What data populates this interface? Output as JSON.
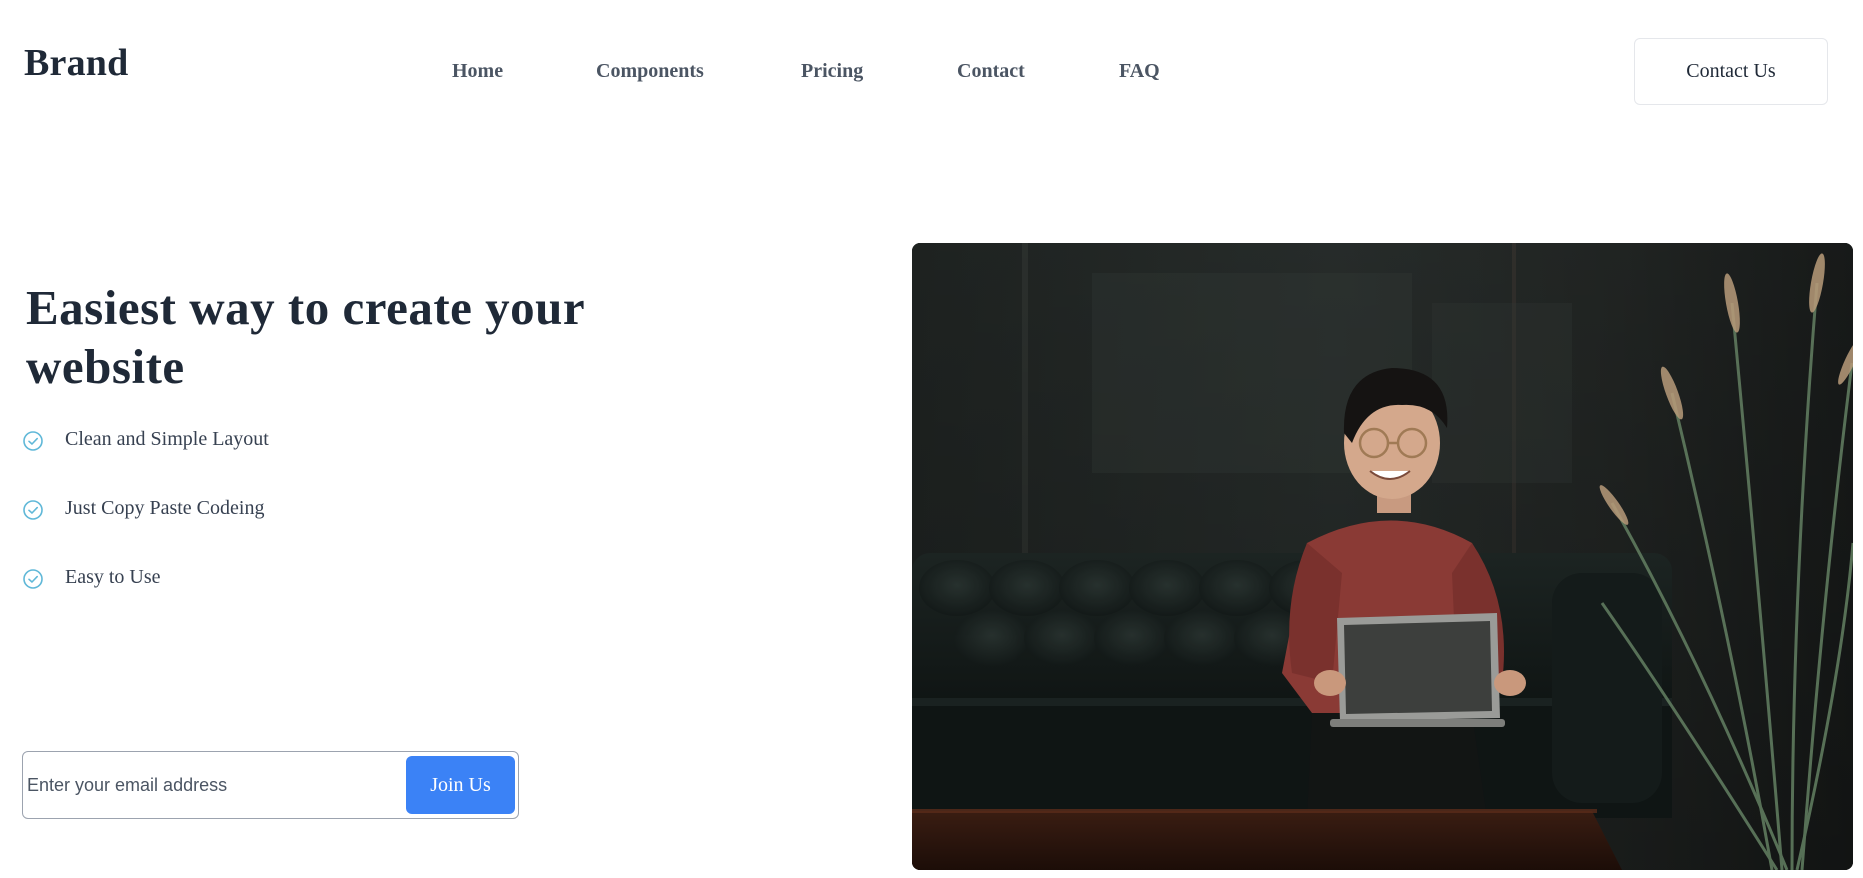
{
  "navbar": {
    "brand": "Brand",
    "links": [
      {
        "label": "Home"
      },
      {
        "label": "Components"
      },
      {
        "label": "Pricing"
      },
      {
        "label": "Contact"
      },
      {
        "label": "FAQ"
      }
    ],
    "cta_label": "Contact Us"
  },
  "hero": {
    "title": "Easiest way to create your website",
    "features": [
      {
        "label": "Clean and Simple Layout",
        "icon": "check-circle-icon"
      },
      {
        "label": "Just Copy Paste Codeing",
        "icon": "check-circle-icon"
      },
      {
        "label": "Easy to Use",
        "icon": "check-circle-icon"
      }
    ],
    "signup": {
      "email_placeholder": "Enter your email address",
      "email_value": "",
      "button_label": "Join Us"
    },
    "image_alt": "Smiling person with glasses using a laptop on a dark leather sofa"
  },
  "colors": {
    "accent": "#3b82f6",
    "check": "#60b8d8",
    "heading": "#1f2937",
    "nav_text": "#4b5563"
  }
}
